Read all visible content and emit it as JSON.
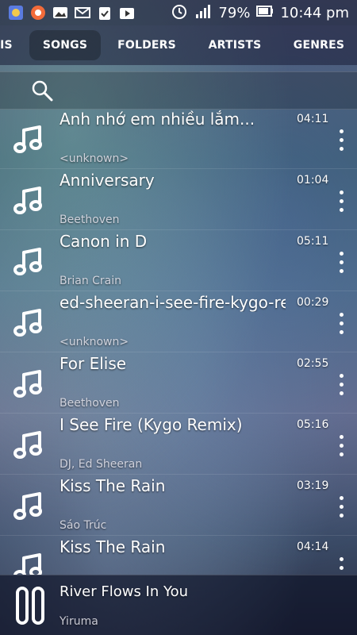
{
  "status_bar": {
    "battery": "79%",
    "time": "10:44 pm",
    "notification_icons": [
      "app-icon",
      "app-icon",
      "image-icon",
      "mail-icon",
      "clipboard-check-icon",
      "video-library-icon"
    ],
    "system_icons": [
      "alarm-icon",
      "signal-icon",
      "battery-icon"
    ]
  },
  "tabs": [
    {
      "label": "IS",
      "active": false
    },
    {
      "label": "SONGS",
      "active": true
    },
    {
      "label": "FOLDERS",
      "active": false
    },
    {
      "label": "ARTISTS",
      "active": false
    },
    {
      "label": "GENRES",
      "active": false
    }
  ],
  "search": {
    "icon": "search-icon"
  },
  "songs": [
    {
      "title": "Anh nhớ em nhiều lắm...",
      "duration": "04:11",
      "artist": "<unknown>"
    },
    {
      "title": "Anniversary",
      "duration": "01:04",
      "artist": "Beethoven"
    },
    {
      "title": "Canon in D",
      "duration": "05:11",
      "artist": "Brian Crain"
    },
    {
      "title": "ed-sheeran-i-see-fire-kygo-re...",
      "duration": "00:29",
      "artist": "<unknown>"
    },
    {
      "title": "For Elise",
      "duration": "02:55",
      "artist": "Beethoven"
    },
    {
      "title": "I See Fire (Kygo Remix)",
      "duration": "05:16",
      "artist": "DJ, Ed Sheeran"
    },
    {
      "title": "Kiss The Rain",
      "duration": "03:19",
      "artist": "Sáo Trúc"
    },
    {
      "title": "Kiss The Rain",
      "duration": "04:14",
      "artist": ""
    }
  ],
  "now_playing": {
    "title": "River Flows In You",
    "artist": "Yiruma",
    "icon": "pause-icon"
  }
}
